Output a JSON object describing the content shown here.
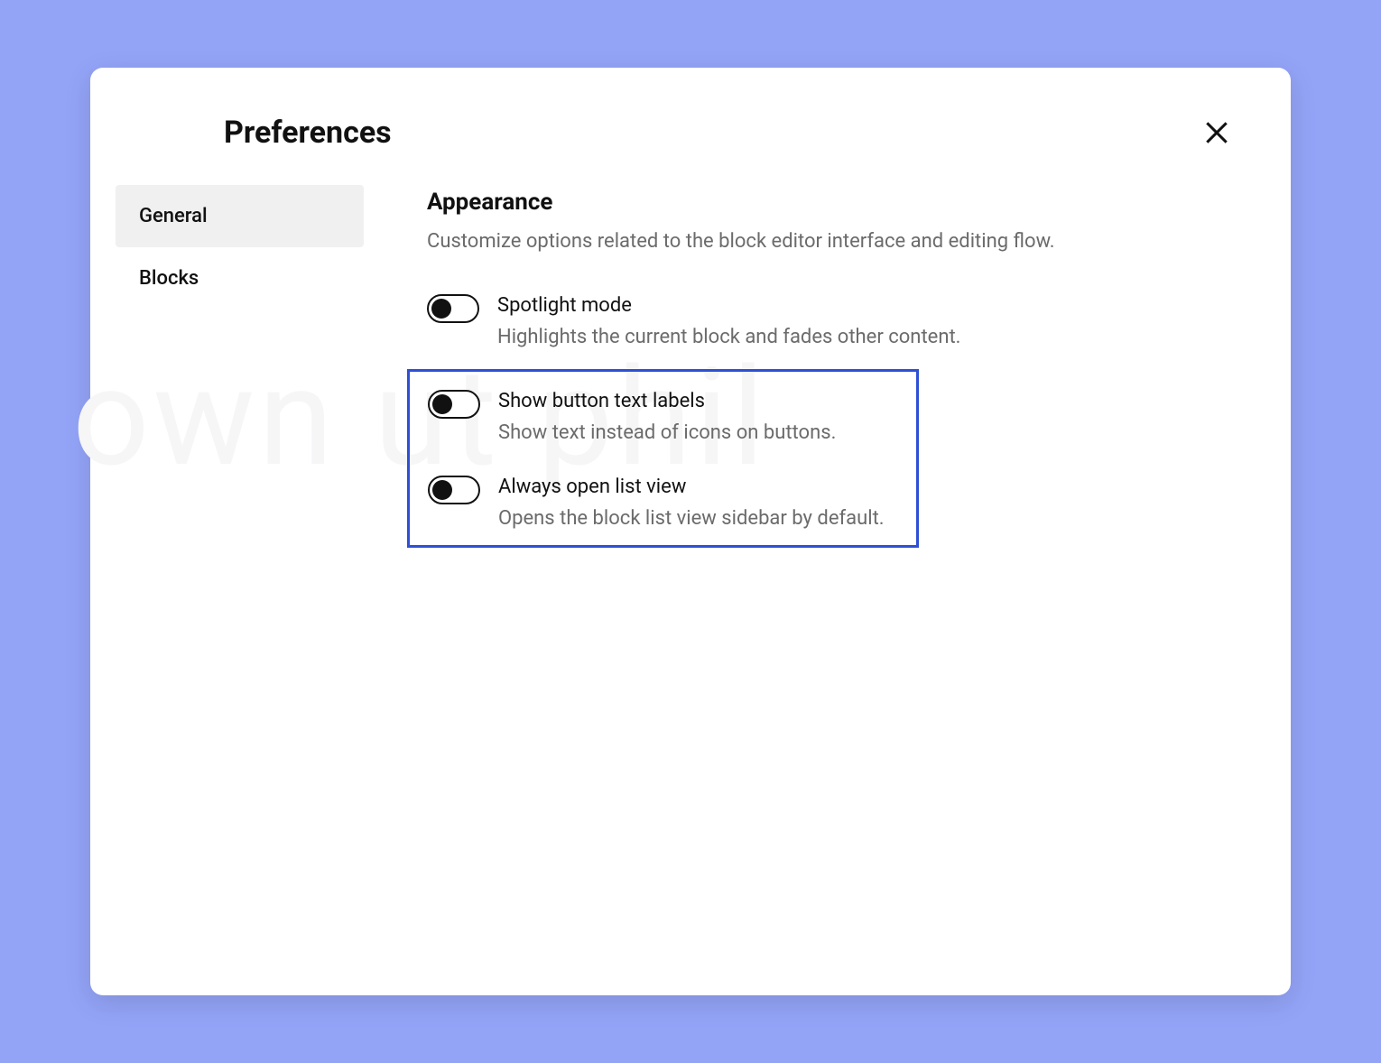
{
  "modal": {
    "title": "Preferences"
  },
  "sidebar": {
    "items": [
      {
        "label": "General",
        "active": true
      },
      {
        "label": "Blocks",
        "active": false
      }
    ]
  },
  "section": {
    "title": "Appearance",
    "description": "Customize options related to the block editor interface and editing flow."
  },
  "settings": [
    {
      "label": "Spotlight mode",
      "description": "Highlights the current block and fades other content.",
      "value": false
    },
    {
      "label": "Show button text labels",
      "description": "Show text instead of icons on buttons.",
      "value": false
    },
    {
      "label": "Always open list view",
      "description": "Opens the block list view sidebar by default.",
      "value": false
    }
  ],
  "bg_watermark": "own     ut phil"
}
